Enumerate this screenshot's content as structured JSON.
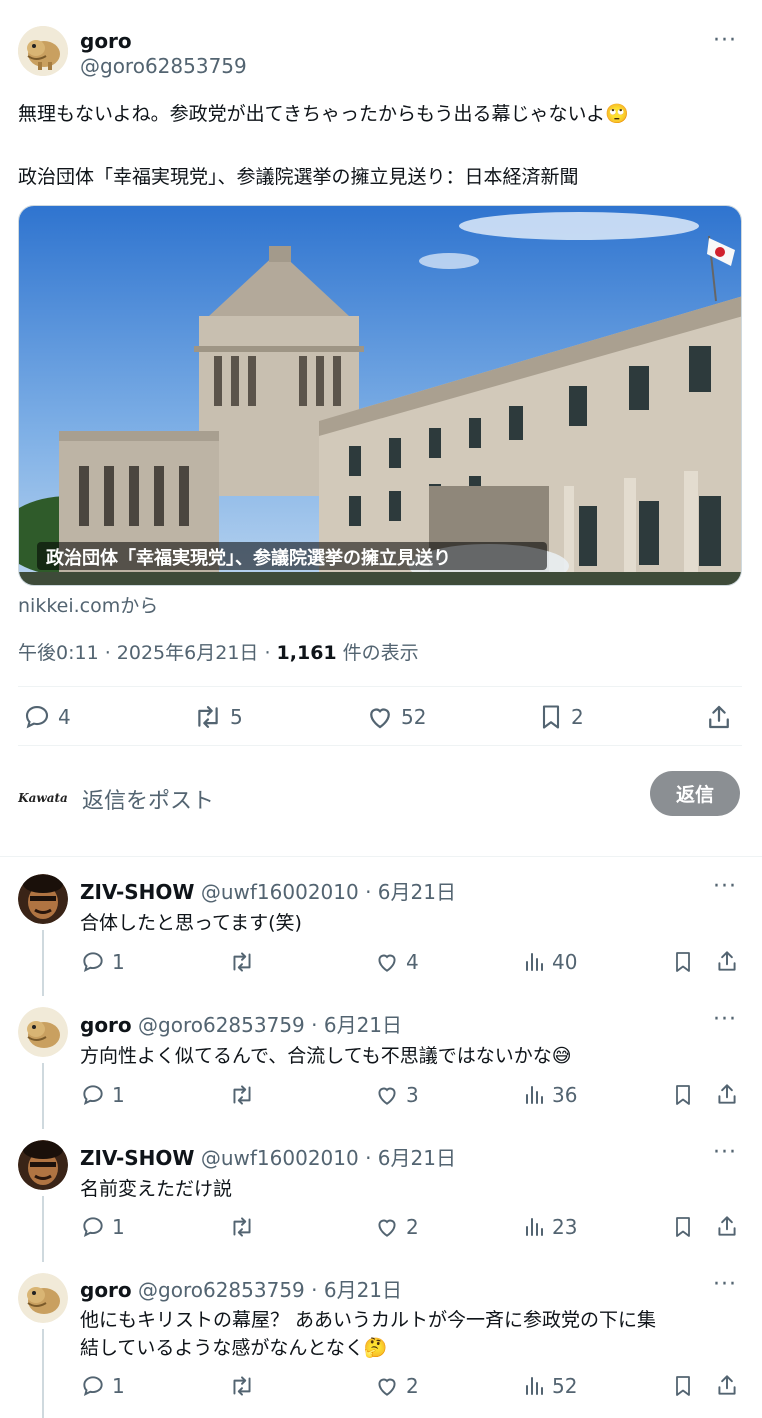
{
  "main": {
    "author": {
      "name": "goro",
      "handle": "@goro62853759"
    },
    "text_line1": "無理もないよね。参政党が出てきちゃったからもう出る幕じゃないよ",
    "text_line1_emoji": "🙄",
    "text_line2": "政治団体「幸福実現党」、参議院選挙の擁立見送り：日本経済新聞",
    "card": {
      "caption": "政治団体「幸福実現党」、参議院選挙の擁立見送り",
      "source": "nikkei.comから"
    },
    "meta": {
      "time": "午後0:11 · 2025年6月21日 · ",
      "views": "1,161",
      "views_label": " 件の表示"
    },
    "actions": {
      "replies": "4",
      "reposts": "5",
      "likes": "52",
      "bookmarks": "2"
    }
  },
  "compose": {
    "avatar_text": "Kawata",
    "placeholder": "返信をポスト",
    "button": "返信"
  },
  "replies": [
    {
      "name": "ZIV-SHOW",
      "handle": "@uwf16002010 · 6月21日",
      "text": "合体したと思ってます(笑)",
      "replies": "1",
      "likes": "4",
      "views": "40"
    },
    {
      "name": "goro",
      "handle": "@goro62853759 · 6月21日",
      "text": "方向性よく似てるんで、合流しても不思議ではないかな",
      "emoji": "😅",
      "replies": "1",
      "likes": "3",
      "views": "36"
    },
    {
      "name": "ZIV-SHOW",
      "handle": "@uwf16002010 · 6月21日",
      "text": "名前変えただけ説",
      "replies": "1",
      "likes": "2",
      "views": "23"
    },
    {
      "name": "goro",
      "handle": "@goro62853759 · 6月21日",
      "text_line1": "他にもキリストの幕屋？ ああいうカルトが今一斉に参政党の下に集",
      "text_line2": "結しているような感がなんとなく",
      "emoji": "🤔",
      "replies": "1",
      "likes": "2",
      "views": "52"
    }
  ],
  "icons": [
    "more-icon",
    "reply-icon",
    "repost-icon",
    "like-icon",
    "bookmark-icon",
    "share-icon",
    "views-icon"
  ]
}
